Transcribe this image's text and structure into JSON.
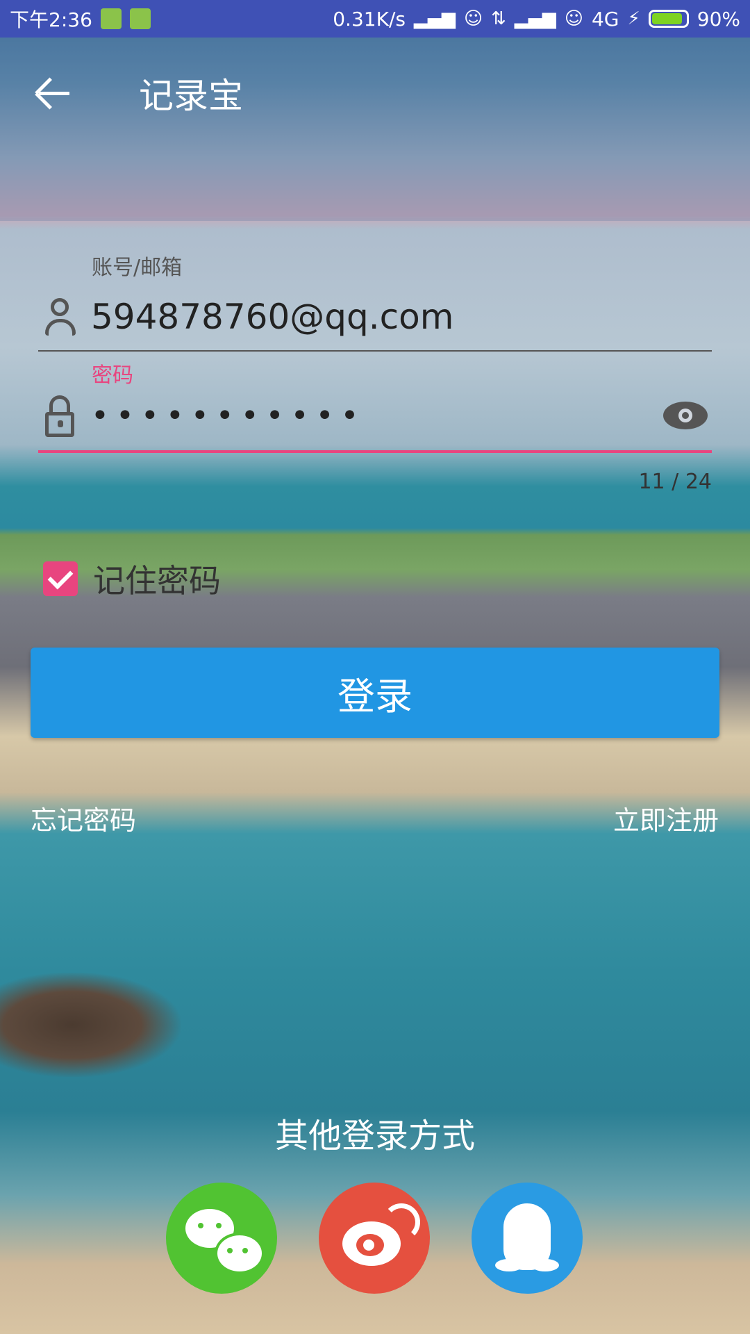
{
  "status_bar": {
    "time": "下午2:36",
    "net_speed": "0.31K/s",
    "network": "4G",
    "battery": "90%",
    "battery_level": 0.9
  },
  "app_bar": {
    "title": "记录宝",
    "back_icon": "arrow-left-icon"
  },
  "form": {
    "account": {
      "label": "账号/邮箱",
      "value": "594878760@qq.com",
      "icon": "person-icon"
    },
    "password": {
      "label": "密码",
      "value_masked": "•••••••••••",
      "counter": "11 / 24",
      "icon": "lock-icon",
      "toggle_icon": "eye-icon"
    },
    "remember": {
      "label": "记住密码",
      "checked": true
    },
    "login_button": "登录",
    "forgot_link": "忘记密码",
    "register_link": "立即注册"
  },
  "social": {
    "title": "其他登录方式",
    "providers": [
      {
        "name": "wechat-icon",
        "color": "#51c332"
      },
      {
        "name": "weibo-icon",
        "color": "#e5503f"
      },
      {
        "name": "qq-icon",
        "color": "#2a9be3"
      }
    ]
  },
  "colors": {
    "status_bar": "#3f51b5",
    "accent": "#e8457f",
    "primary_button": "#2196e3"
  }
}
